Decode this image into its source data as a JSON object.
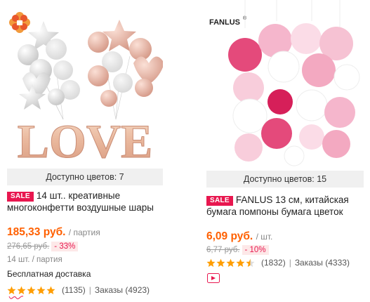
{
  "products": [
    {
      "colors_available": "Доступно цветов: 7",
      "sale_badge": "SALE",
      "title": "14 шт.. креативные многоконфетти воздушные шары",
      "price": "185,33 руб.",
      "price_unit": "/ партия",
      "old_price": "276,65 руб.",
      "discount": "- 33%",
      "quantity": "14 шт. / партия",
      "shipping": "Бесплатная доставка",
      "rating_stars": 5,
      "reviews": "(1135)",
      "orders": "Заказы (4923)",
      "image_text": "LOVE"
    },
    {
      "brand_logo": "FANLUS",
      "brand_mark": "®",
      "colors_available": "Доступно цветов: 15",
      "sale_badge": "SALE",
      "title": "FANLUS 13 см, китайская бумага помпоны бумага цветок",
      "price": "6,09 руб.",
      "price_unit": "/ шт.",
      "old_price": "6,77 руб.",
      "discount": "- 10%",
      "rating_stars": 4.5,
      "reviews": "(1832)",
      "orders": "Заказы (4333)"
    }
  ],
  "colors": {
    "accent_price": "#ff6000",
    "sale": "#e8174f",
    "star": "#ff9d00"
  }
}
